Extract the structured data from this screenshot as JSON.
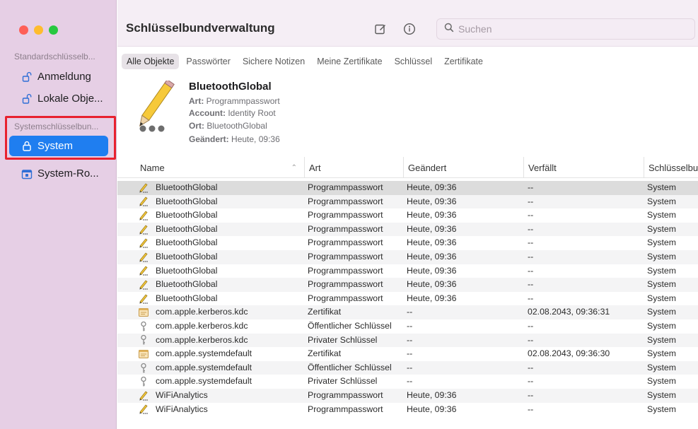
{
  "sidebar": {
    "section_default": "Standardschlüsselb...",
    "section_system": "Systemschlüsselbun...",
    "items": [
      {
        "label": "Anmeldung",
        "icon": "unlock-icon"
      },
      {
        "label": "Lokale Obje...",
        "icon": "unlock-icon"
      },
      {
        "label": "System",
        "icon": "lock-icon",
        "selected": true
      },
      {
        "label": "System-Ro...",
        "icon": "keychain-icon"
      }
    ]
  },
  "toolbar": {
    "title": "Schlüsselbundverwaltung",
    "search_placeholder": "Suchen"
  },
  "tabs": [
    "Alle Objekte",
    "Passwörter",
    "Sichere Notizen",
    "Meine Zertifikate",
    "Schlüssel",
    "Zertifikate"
  ],
  "detail": {
    "title": "BluetoothGlobal",
    "art_label": "Art:",
    "art_value": "Programmpasswort",
    "account_label": "Account:",
    "account_value": "Identity Root",
    "ort_label": "Ort:",
    "ort_value": "BluetoothGlobal",
    "changed_label": "Geändert:",
    "changed_value": "Heute, 09:36"
  },
  "table": {
    "headers": {
      "name": "Name",
      "kind": "Art",
      "modified": "Geändert",
      "expires": "Verfällt",
      "keychain": "Schlüsselbu"
    },
    "rows": [
      {
        "name": "BluetoothGlobal",
        "kind": "Programmpasswort",
        "modified": "Heute, 09:36",
        "expires": "--",
        "keychain": "System",
        "icon": "pencil"
      },
      {
        "name": "BluetoothGlobal",
        "kind": "Programmpasswort",
        "modified": "Heute, 09:36",
        "expires": "--",
        "keychain": "System",
        "icon": "pencil"
      },
      {
        "name": "BluetoothGlobal",
        "kind": "Programmpasswort",
        "modified": "Heute, 09:36",
        "expires": "--",
        "keychain": "System",
        "icon": "pencil"
      },
      {
        "name": "BluetoothGlobal",
        "kind": "Programmpasswort",
        "modified": "Heute, 09:36",
        "expires": "--",
        "keychain": "System",
        "icon": "pencil"
      },
      {
        "name": "BluetoothGlobal",
        "kind": "Programmpasswort",
        "modified": "Heute, 09:36",
        "expires": "--",
        "keychain": "System",
        "icon": "pencil"
      },
      {
        "name": "BluetoothGlobal",
        "kind": "Programmpasswort",
        "modified": "Heute, 09:36",
        "expires": "--",
        "keychain": "System",
        "icon": "pencil"
      },
      {
        "name": "BluetoothGlobal",
        "kind": "Programmpasswort",
        "modified": "Heute, 09:36",
        "expires": "--",
        "keychain": "System",
        "icon": "pencil"
      },
      {
        "name": "BluetoothGlobal",
        "kind": "Programmpasswort",
        "modified": "Heute, 09:36",
        "expires": "--",
        "keychain": "System",
        "icon": "pencil"
      },
      {
        "name": "BluetoothGlobal",
        "kind": "Programmpasswort",
        "modified": "Heute, 09:36",
        "expires": "--",
        "keychain": "System",
        "icon": "pencil"
      },
      {
        "name": "com.apple.kerberos.kdc",
        "kind": "Zertifikat",
        "modified": "--",
        "expires": "02.08.2043, 09:36:31",
        "keychain": "System",
        "icon": "certificate"
      },
      {
        "name": "com.apple.kerberos.kdc",
        "kind": "Öffentlicher Schlüssel",
        "modified": "--",
        "expires": "--",
        "keychain": "System",
        "icon": "key"
      },
      {
        "name": "com.apple.kerberos.kdc",
        "kind": "Privater Schlüssel",
        "modified": "--",
        "expires": "--",
        "keychain": "System",
        "icon": "key"
      },
      {
        "name": "com.apple.systemdefault",
        "kind": "Zertifikat",
        "modified": "--",
        "expires": "02.08.2043, 09:36:30",
        "keychain": "System",
        "icon": "certificate"
      },
      {
        "name": "com.apple.systemdefault",
        "kind": "Öffentlicher Schlüssel",
        "modified": "--",
        "expires": "--",
        "keychain": "System",
        "icon": "key"
      },
      {
        "name": "com.apple.systemdefault",
        "kind": "Privater Schlüssel",
        "modified": "--",
        "expires": "--",
        "keychain": "System",
        "icon": "key"
      },
      {
        "name": "WiFiAnalytics",
        "kind": "Programmpasswort",
        "modified": "Heute, 09:36",
        "expires": "--",
        "keychain": "System",
        "icon": "pencil"
      },
      {
        "name": "WiFiAnalytics",
        "kind": "Programmpasswort",
        "modified": "Heute, 09:36",
        "expires": "--",
        "keychain": "System",
        "icon": "pencil"
      }
    ]
  },
  "colors": {
    "accent": "#1f7ef0",
    "sidebar": "#e6cfe5",
    "highlight": "#e8222f"
  }
}
